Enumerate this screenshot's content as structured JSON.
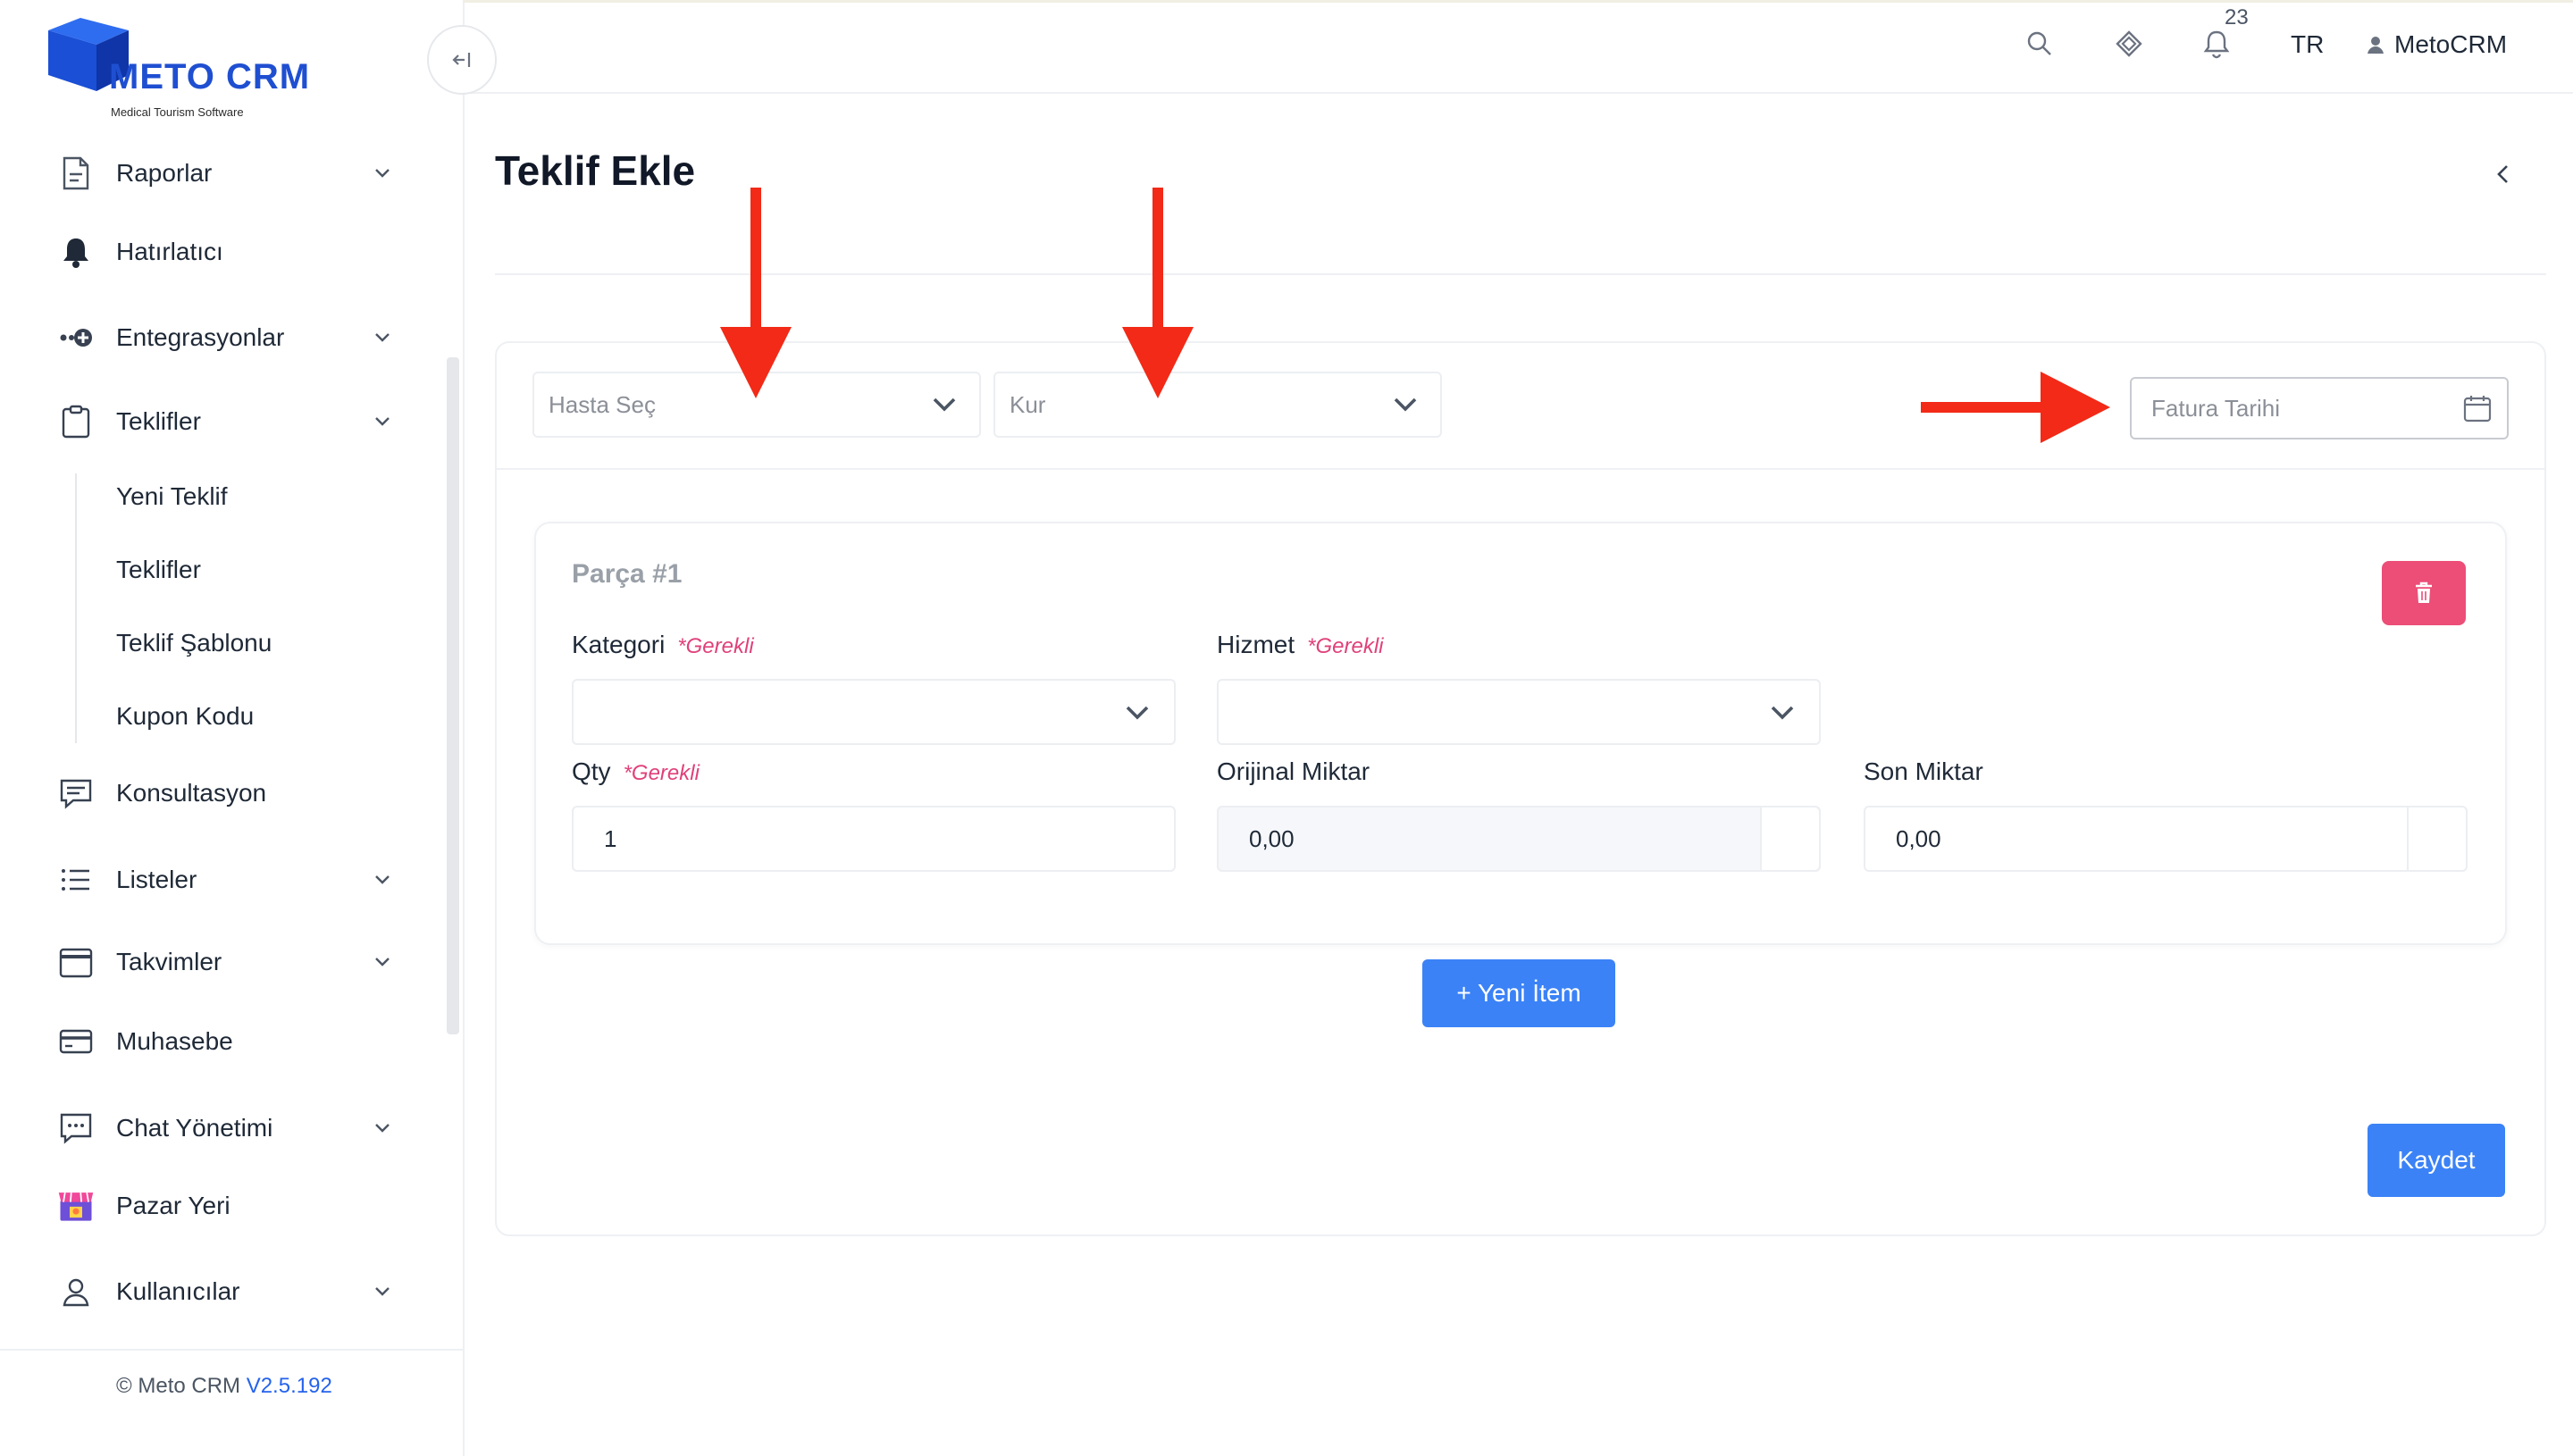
{
  "brand": {
    "name": "METO CRM",
    "tagline": "Medical Tourism Software"
  },
  "sidebar": {
    "items": [
      {
        "label": "Raporlar"
      },
      {
        "label": "Hatırlatıcı"
      },
      {
        "label": "Entegrasyonlar"
      },
      {
        "label": "Teklifler"
      },
      {
        "label": "Konsultasyon"
      },
      {
        "label": "Listeler"
      },
      {
        "label": "Takvimler"
      },
      {
        "label": "Muhasebe"
      },
      {
        "label": "Chat Yönetimi"
      },
      {
        "label": "Pazar Yeri"
      },
      {
        "label": "Kullanıcılar"
      }
    ],
    "sub_items": [
      {
        "label": "Yeni Teklif"
      },
      {
        "label": "Teklifler"
      },
      {
        "label": "Teklif Şablonu"
      },
      {
        "label": "Kupon Kodu"
      }
    ],
    "footer": {
      "text": "© Meto CRM",
      "version": "V2.5.192"
    }
  },
  "topbar": {
    "notifications": "23",
    "language": "TR",
    "user": "MetoCRM"
  },
  "page": {
    "title": "Teklif Ekle"
  },
  "form": {
    "patient_placeholder": "Hasta Seç",
    "currency_placeholder": "Kur",
    "date_placeholder": "Fatura Tarihi"
  },
  "part": {
    "title": "Parça #1",
    "required_text": "*Gerekli",
    "fields": {
      "kategori": "Kategori",
      "hizmet": "Hizmet",
      "qty": "Qty",
      "orijinal": "Orijinal Miktar",
      "son": "Son Miktar"
    },
    "values": {
      "qty": "1",
      "orijinal": "0,00",
      "son": "0,00"
    }
  },
  "buttons": {
    "new_item": "+  Yeni İtem",
    "save": "Kaydet"
  },
  "colors": {
    "primary": "#3b82f6",
    "danger": "#ec4e78",
    "required": "#e0417a",
    "annotation": "#f22a17"
  }
}
